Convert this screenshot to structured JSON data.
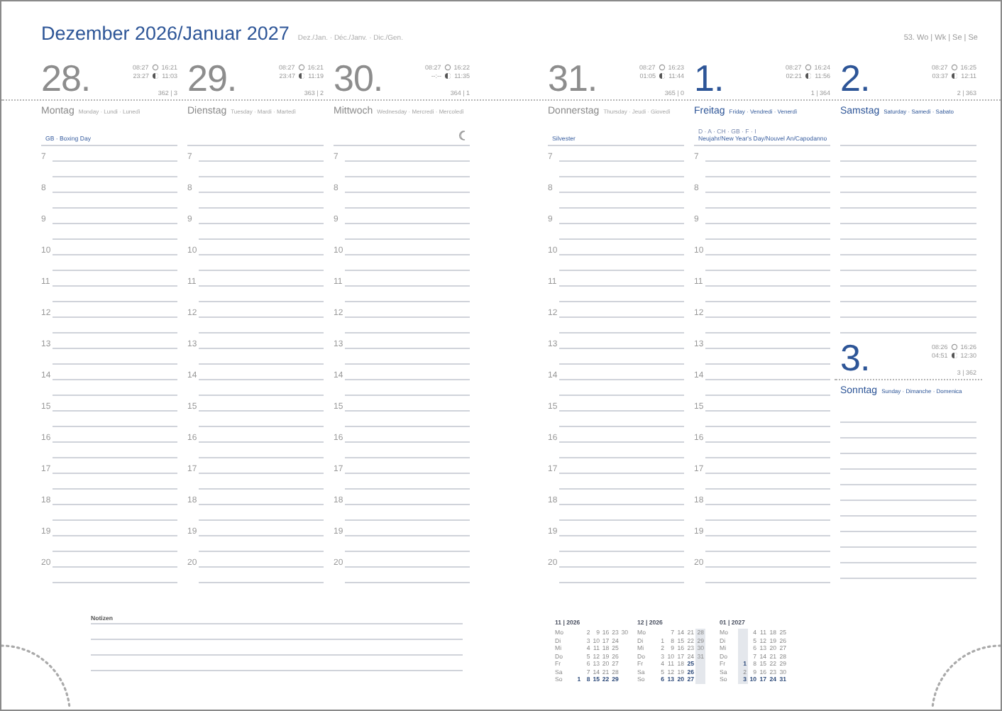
{
  "header": {
    "title": "Dezember 2026/Januar 2027",
    "subtitle": "Dez./Jan. · Déc./Janv. · Dic./Gen.",
    "week": "53. Wo | Wk | Se | Se"
  },
  "days": [
    {
      "kind": "hours",
      "number": "28.",
      "highlight": false,
      "sunrise": "08:27",
      "sunset": "16:21",
      "moonrise": "23:27",
      "moonset": "11:03",
      "day_count": "362 | 3",
      "weekday": "Montag",
      "weekday_other": "Monday · Lundi · Lunedì",
      "events": [
        "GB · Boxing Day"
      ],
      "moon_phase": false,
      "hours": [
        "7",
        "8",
        "9",
        "10",
        "11",
        "12",
        "13",
        "14",
        "15",
        "16",
        "17",
        "18",
        "19",
        "20"
      ]
    },
    {
      "kind": "hours",
      "number": "29.",
      "highlight": false,
      "sunrise": "08:27",
      "sunset": "16:21",
      "moonrise": "23:47",
      "moonset": "11:19",
      "day_count": "363 | 2",
      "weekday": "Dienstag",
      "weekday_other": "Tuesday · Mardi · Martedì",
      "moon_phase": false,
      "hours": [
        "7",
        "8",
        "9",
        "10",
        "11",
        "12",
        "13",
        "14",
        "15",
        "16",
        "17",
        "18",
        "19",
        "20"
      ]
    },
    {
      "kind": "hours",
      "number": "30.",
      "highlight": false,
      "sunrise": "08:27",
      "sunset": "16:22",
      "moonrise": "--:--",
      "moonset": "11:35",
      "day_count": "364 | 1",
      "weekday": "Mittwoch",
      "weekday_other": "Wednesday · Mercredi · Mercoledì",
      "moon_phase": true,
      "hours": [
        "7",
        "8",
        "9",
        "10",
        "11",
        "12",
        "13",
        "14",
        "15",
        "16",
        "17",
        "18",
        "19",
        "20"
      ]
    },
    {
      "kind": "hours",
      "number": "31.",
      "highlight": false,
      "sunrise": "08:27",
      "sunset": "16:23",
      "moonrise": "01:05",
      "moonset": "11:44",
      "day_count": "365 | 0",
      "weekday": "Donnerstag",
      "weekday_other": "Thursday · Jeudi · Giovedì",
      "events": [
        "Silvester"
      ],
      "moon_phase": false,
      "hours": [
        "7",
        "8",
        "9",
        "10",
        "11",
        "12",
        "13",
        "14",
        "15",
        "16",
        "17",
        "18",
        "19",
        "20"
      ]
    },
    {
      "kind": "hours",
      "number": "1.",
      "highlight": true,
      "sunrise": "08:27",
      "sunset": "16:24",
      "moonrise": "02:21",
      "moonset": "11:56",
      "day_count": "1 | 364",
      "weekday": "Freitag",
      "weekday_other": "Friday · Vendredi · Venerdì",
      "events": [
        "D · A · CH · GB · F · I",
        "Neujahr/New Year's Day/Nouvel An/Capodanno"
      ],
      "moon_phase": false,
      "hours": [
        "7",
        "8",
        "9",
        "10",
        "11",
        "12",
        "13",
        "14",
        "15",
        "16",
        "17",
        "18",
        "19",
        "20"
      ]
    },
    {
      "kind": "weekend",
      "number": "2.",
      "highlight": true,
      "sunrise": "08:27",
      "sunset": "16:25",
      "moonrise": "03:37",
      "moonset": "12:11",
      "day_count": "2 | 363",
      "weekday": "Samstag",
      "weekday_other": "Saturday · Samedi · Sabato",
      "moon_phase": false,
      "sunday": {
        "number": "3.",
        "highlight": true,
        "sunrise": "08:26",
        "sunset": "16:26",
        "moonrise": "04:51",
        "moonset": "12:30",
        "day_count": "3 | 362",
        "weekday": "Sonntag",
        "weekday_other": "Sunday · Dimanche · Domenica"
      }
    }
  ],
  "notes": {
    "label": "Notizen"
  },
  "mini_calendars": [
    {
      "title": "11 | 2026",
      "weekdays": [
        "Mo",
        "Di",
        "Mi",
        "Do",
        "Fr",
        "Sa",
        "So"
      ],
      "weeks": [
        {
          "current": false,
          "kind": "first",
          "days": [
            {
              "d": "1",
              "bold": true
            }
          ]
        },
        {
          "current": false,
          "days": [
            {
              "d": "2",
              "bold": false
            },
            {
              "d": "3",
              "bold": false
            },
            {
              "d": "4",
              "bold": false
            },
            {
              "d": "5",
              "bold": false
            },
            {
              "d": "6",
              "bold": false
            },
            {
              "d": "7",
              "bold": false
            },
            {
              "d": "8",
              "bold": true
            }
          ]
        },
        {
          "current": false,
          "days": [
            {
              "d": "9",
              "bold": false
            },
            {
              "d": "10",
              "bold": false
            },
            {
              "d": "11",
              "bold": false
            },
            {
              "d": "12",
              "bold": false
            },
            {
              "d": "13",
              "bold": false
            },
            {
              "d": "14",
              "bold": false
            },
            {
              "d": "15",
              "bold": true
            }
          ]
        },
        {
          "current": false,
          "days": [
            {
              "d": "16",
              "bold": false
            },
            {
              "d": "17",
              "bold": false
            },
            {
              "d": "18",
              "bold": false
            },
            {
              "d": "19",
              "bold": false
            },
            {
              "d": "20",
              "bold": false
            },
            {
              "d": "21",
              "bold": false
            },
            {
              "d": "22",
              "bold": true
            }
          ]
        },
        {
          "current": false,
          "days": [
            {
              "d": "23",
              "bold": false
            },
            {
              "d": "24",
              "bold": false
            },
            {
              "d": "25",
              "bold": false
            },
            {
              "d": "26",
              "bold": false
            },
            {
              "d": "27",
              "bold": false
            },
            {
              "d": "28",
              "bold": false
            },
            {
              "d": "29",
              "bold": true
            }
          ]
        },
        {
          "current": false,
          "kind": "last",
          "days": [
            {
              "d": "30",
              "bold": false
            }
          ]
        }
      ]
    },
    {
      "title": "12 | 2026",
      "weekdays": [
        "Mo",
        "Di",
        "Mi",
        "Do",
        "Fr",
        "Sa",
        "So"
      ],
      "weeks": [
        {
          "current": false,
          "kind": "first",
          "days": [
            {
              "d": "1",
              "bold": false
            },
            {
              "d": "2",
              "bold": false
            },
            {
              "d": "3",
              "bold": false
            },
            {
              "d": "4",
              "bold": false
            },
            {
              "d": "5",
              "bold": false
            },
            {
              "d": "6",
              "bold": true
            }
          ]
        },
        {
          "current": false,
          "days": [
            {
              "d": "7",
              "bold": false
            },
            {
              "d": "8",
              "bold": false
            },
            {
              "d": "9",
              "bold": false
            },
            {
              "d": "10",
              "bold": false
            },
            {
              "d": "11",
              "bold": false
            },
            {
              "d": "12",
              "bold": false
            },
            {
              "d": "13",
              "bold": true
            }
          ]
        },
        {
          "current": false,
          "days": [
            {
              "d": "14",
              "bold": false
            },
            {
              "d": "15",
              "bold": false
            },
            {
              "d": "16",
              "bold": false
            },
            {
              "d": "17",
              "bold": false
            },
            {
              "d": "18",
              "bold": false
            },
            {
              "d": "19",
              "bold": false
            },
            {
              "d": "20",
              "bold": true
            }
          ]
        },
        {
          "current": false,
          "days": [
            {
              "d": "21",
              "bold": false
            },
            {
              "d": "22",
              "bold": false
            },
            {
              "d": "23",
              "bold": false
            },
            {
              "d": "24",
              "bold": false
            },
            {
              "d": "25",
              "bold": true
            },
            {
              "d": "26",
              "bold": true
            },
            {
              "d": "27",
              "bold": true
            }
          ]
        },
        {
          "current": true,
          "kind": "last",
          "days": [
            {
              "d": "28",
              "bold": false
            },
            {
              "d": "29",
              "bold": false
            },
            {
              "d": "30",
              "bold": false
            },
            {
              "d": "31",
              "bold": false
            }
          ]
        }
      ]
    },
    {
      "title": "01 | 2027",
      "weekdays": [
        "Mo",
        "Di",
        "Mi",
        "Do",
        "Fr",
        "Sa",
        "So"
      ],
      "weeks": [
        {
          "current": true,
          "kind": "first",
          "days": [
            {
              "d": "1",
              "bold": true
            },
            {
              "d": "2",
              "bold": false
            },
            {
              "d": "3",
              "bold": true
            }
          ]
        },
        {
          "current": false,
          "days": [
            {
              "d": "4",
              "bold": false
            },
            {
              "d": "5",
              "bold": false
            },
            {
              "d": "6",
              "bold": false
            },
            {
              "d": "7",
              "bold": false
            },
            {
              "d": "8",
              "bold": false
            },
            {
              "d": "9",
              "bold": false
            },
            {
              "d": "10",
              "bold": true
            }
          ]
        },
        {
          "current": false,
          "days": [
            {
              "d": "11",
              "bold": false
            },
            {
              "d": "12",
              "bold": false
            },
            {
              "d": "13",
              "bold": false
            },
            {
              "d": "14",
              "bold": false
            },
            {
              "d": "15",
              "bold": false
            },
            {
              "d": "16",
              "bold": false
            },
            {
              "d": "17",
              "bold": true
            }
          ]
        },
        {
          "current": false,
          "days": [
            {
              "d": "18",
              "bold": false
            },
            {
              "d": "19",
              "bold": false
            },
            {
              "d": "20",
              "bold": false
            },
            {
              "d": "21",
              "bold": false
            },
            {
              "d": "22",
              "bold": false
            },
            {
              "d": "23",
              "bold": false
            },
            {
              "d": "24",
              "bold": true
            }
          ]
        },
        {
          "current": false,
          "days": [
            {
              "d": "25",
              "bold": false
            },
            {
              "d": "26",
              "bold": false
            },
            {
              "d": "27",
              "bold": false
            },
            {
              "d": "28",
              "bold": false
            },
            {
              "d": "29",
              "bold": false
            },
            {
              "d": "30",
              "bold": false
            },
            {
              "d": "31",
              "bold": true
            }
          ]
        }
      ]
    }
  ]
}
